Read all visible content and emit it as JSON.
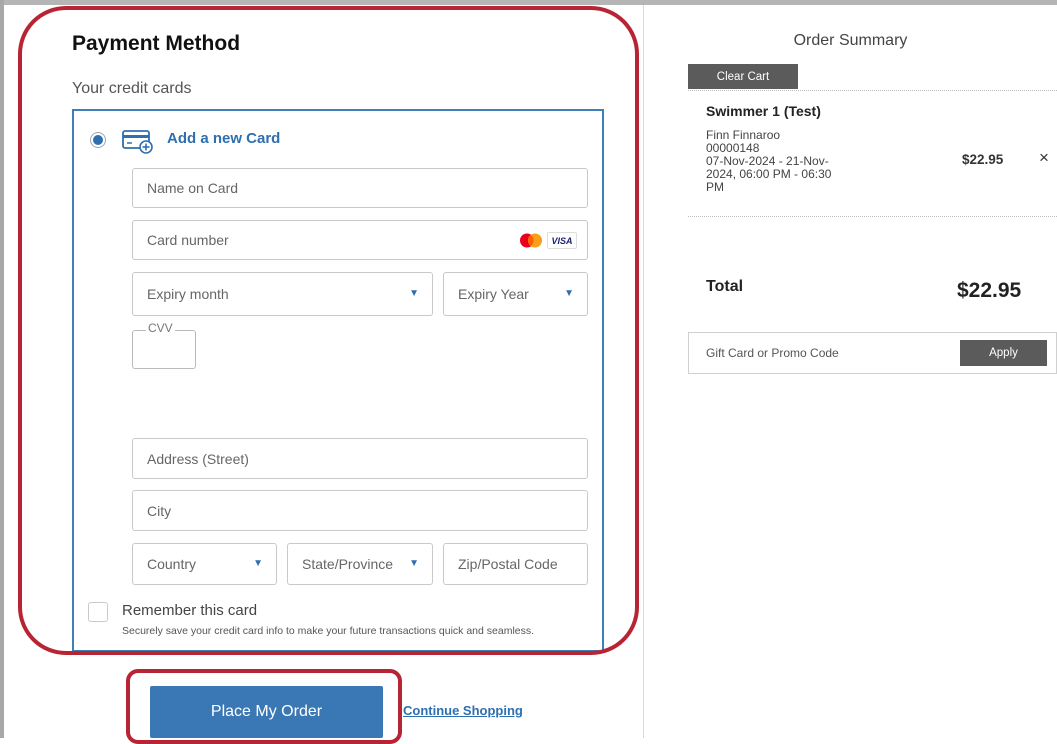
{
  "payment": {
    "title": "Payment Method",
    "subtitle": "Your credit cards",
    "add_card_label": "Add a new Card",
    "name_placeholder": "Name on Card",
    "card_number_placeholder": "Card number",
    "expiry_month": "Expiry month",
    "expiry_year": "Expiry Year",
    "cvv_label": "CVV",
    "address_placeholder": "Address (Street)",
    "city_placeholder": "City",
    "country": "Country",
    "state": "State/Province",
    "zip_placeholder": "Zip/Postal Code",
    "remember_label": "Remember this card",
    "remember_help": "Securely save your credit card info to make your future transactions quick and seamless.",
    "card_brands": [
      "mastercard-icon",
      "visa-icon"
    ],
    "visa_text": "VISA"
  },
  "actions": {
    "place_order": "Place My Order",
    "continue_shopping": "Continue Shopping"
  },
  "summary": {
    "title": "Order Summary",
    "clear_cart": "Clear Cart",
    "item": {
      "name": "Swimmer 1 (Test)",
      "line1": "Finn Finnaroo",
      "line2": "00000148",
      "line3": "07-Nov-2024 - 21-Nov-",
      "line4": "2024, 06:00 PM - 06:30",
      "line5": "PM",
      "price": "$22.95",
      "remove": "×"
    },
    "total_label": "Total",
    "total_value": "$22.95",
    "promo_placeholder": "Gift Card or Promo Code",
    "apply": "Apply"
  },
  "colors": {
    "accent_blue": "#3a78b5",
    "highlight_red": "#b72534",
    "dark_button": "#5b5b5b"
  }
}
